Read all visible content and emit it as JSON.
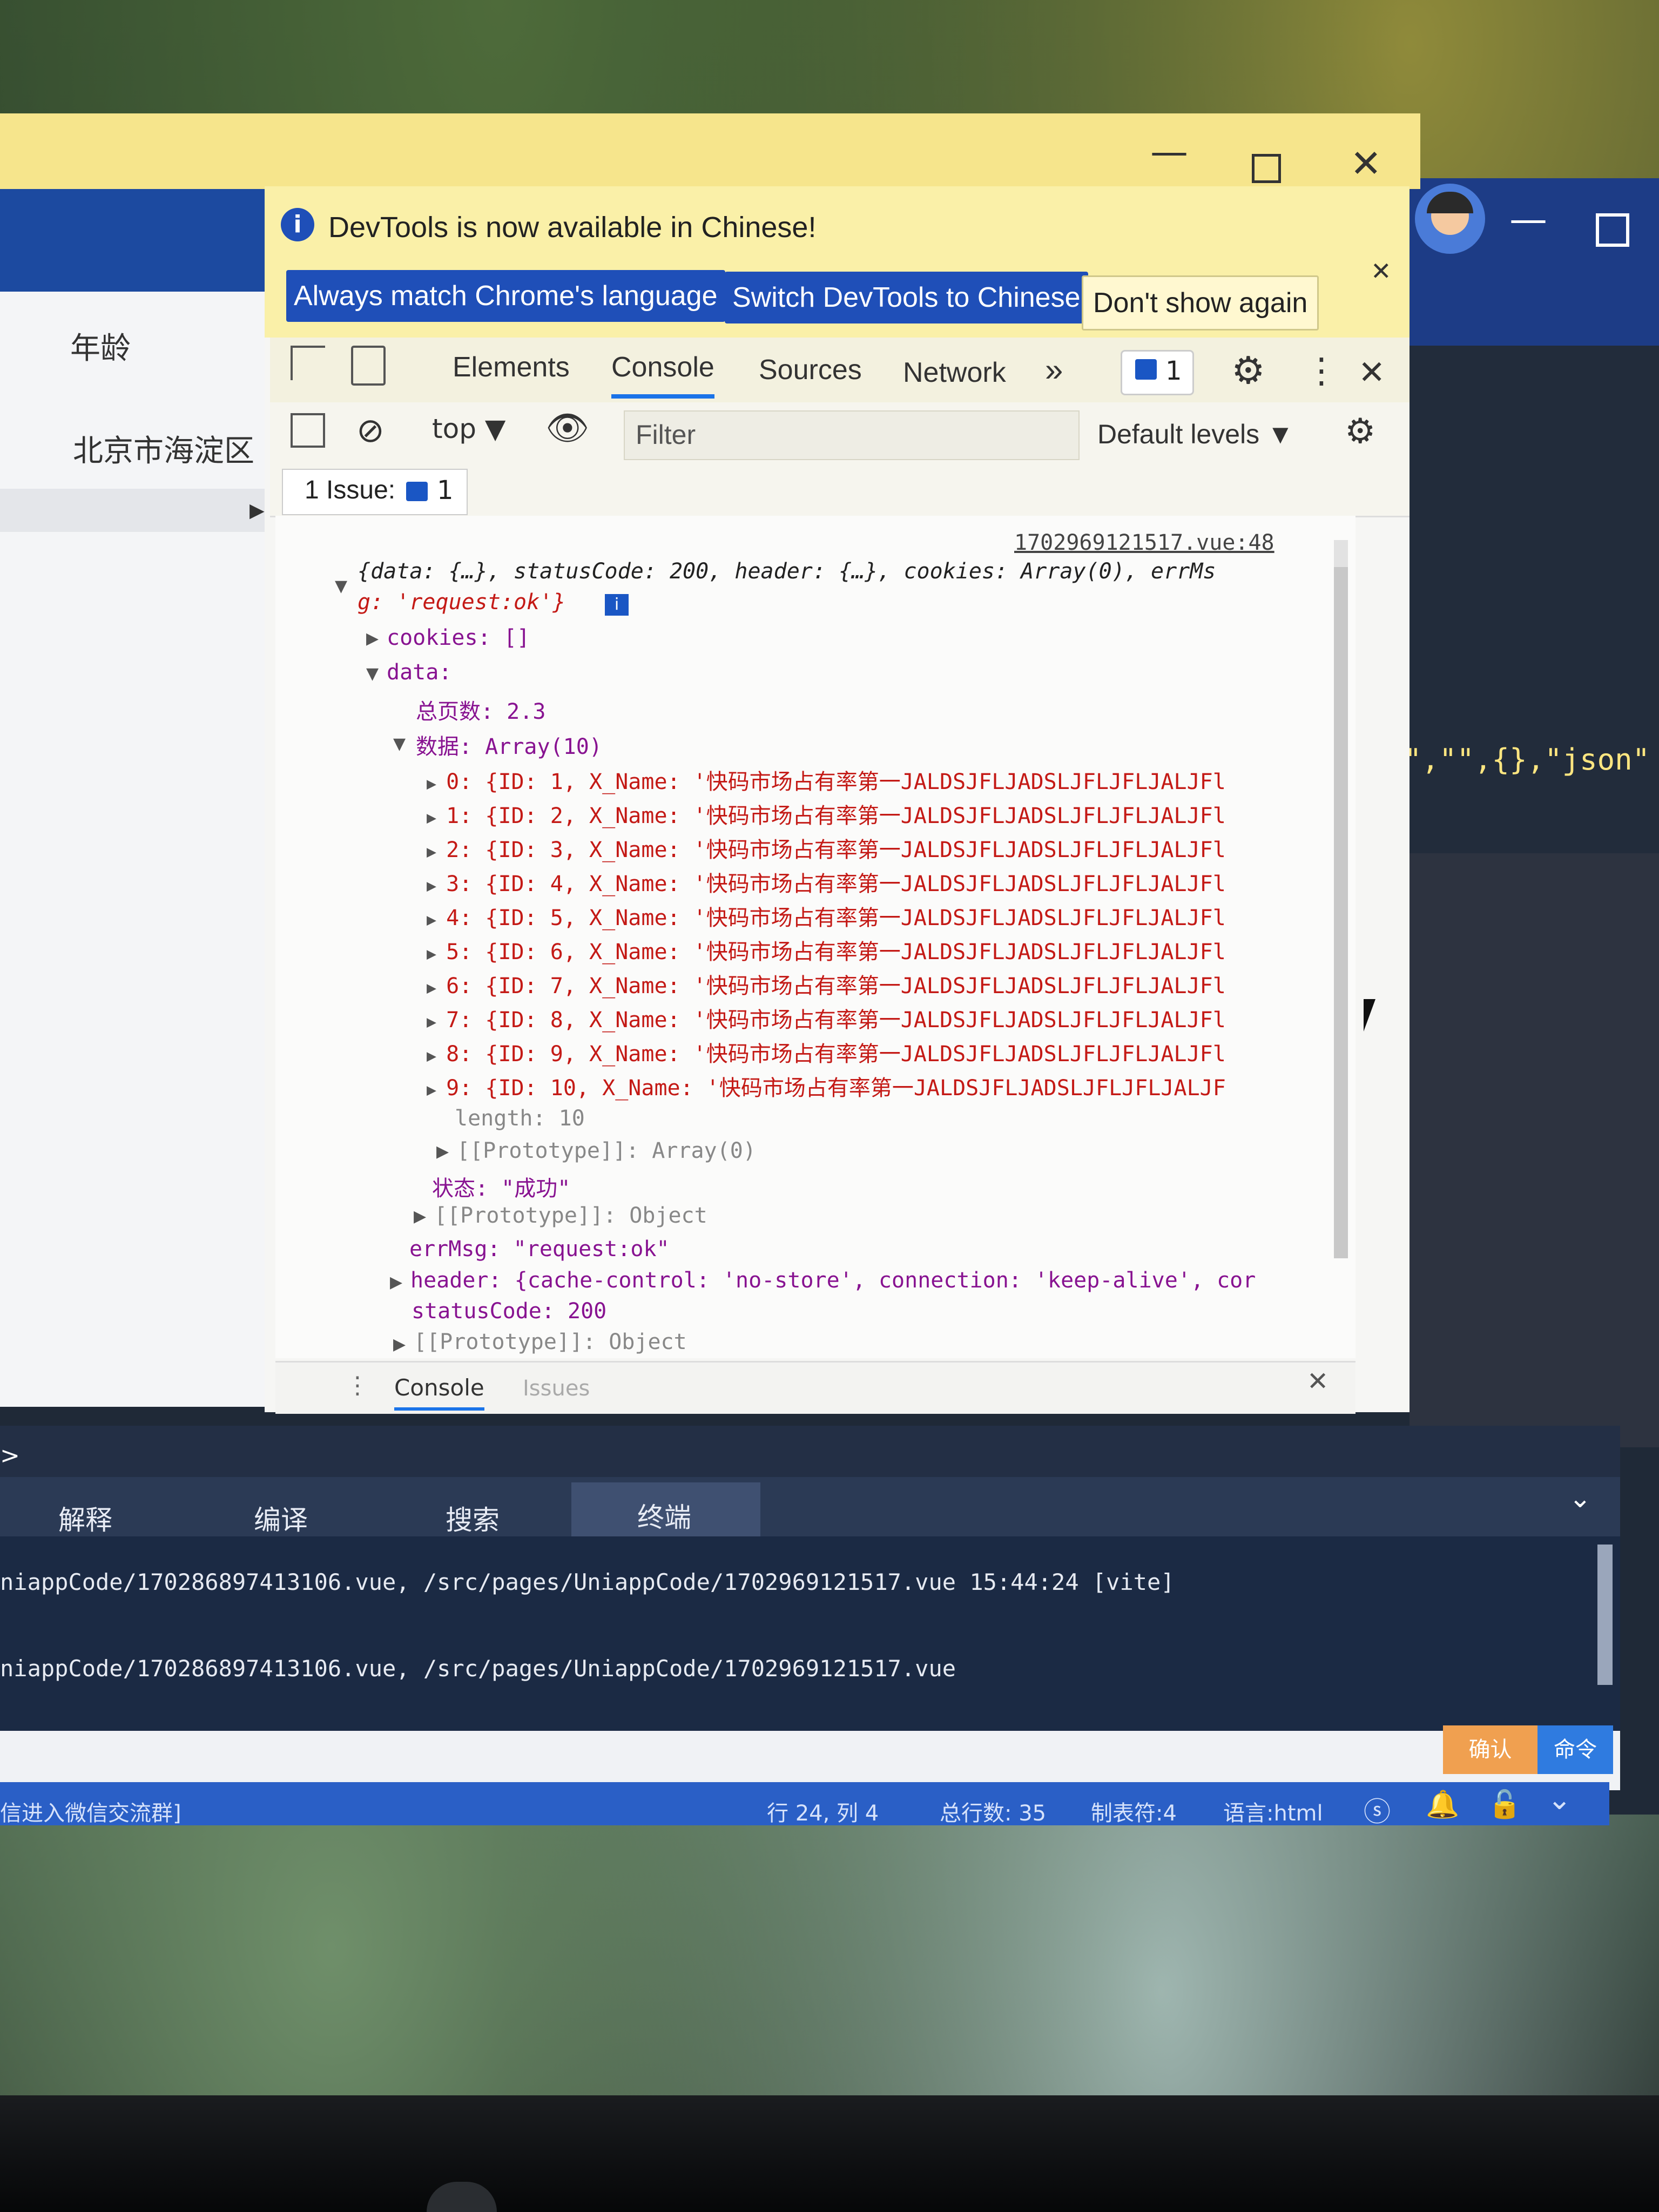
{
  "devtools": {
    "infobar": {
      "message": "DevTools is now available in Chinese!",
      "btn_match": "Always match Chrome's language",
      "btn_switch": "Switch DevTools to Chinese",
      "btn_dont": "Don't show again"
    },
    "tabs": {
      "elements": "Elements",
      "console": "Console",
      "sources": "Sources",
      "network": "Network",
      "more": "»",
      "issues_count": "1"
    },
    "toolbar": {
      "context": "top",
      "filter_placeholder": "Filter",
      "levels": "Default levels"
    },
    "issues_bar": {
      "label": "1 Issue:",
      "count": "1"
    },
    "console": {
      "source_link": "1702969121517.vue:48",
      "summary_1": "{data: {…}, statusCode: 200, header: {…}, cookies: Array(0), errMs",
      "summary_2": "g: 'request:ok'}",
      "cookies": "cookies: []",
      "data_key": "data:",
      "total_pages": "总页数: 2.3",
      "rows_key": "数据: Array(10)",
      "rows": [
        "0: {ID: 1, X_Name: '快码市场占有率第一JALDSJFLJADSLJFLJFLJALJFl",
        "1: {ID: 2, X_Name: '快码市场占有率第一JALDSJFLJADSLJFLJFLJALJFl",
        "2: {ID: 3, X_Name: '快码市场占有率第一JALDSJFLJADSLJFLJFLJALJFl",
        "3: {ID: 4, X_Name: '快码市场占有率第一JALDSJFLJADSLJFLJFLJALJFl",
        "4: {ID: 5, X_Name: '快码市场占有率第一JALDSJFLJADSLJFLJFLJALJFl",
        "5: {ID: 6, X_Name: '快码市场占有率第一JALDSJFLJADSLJFLJFLJALJFl",
        "6: {ID: 7, X_Name: '快码市场占有率第一JALDSJFLJADSLJFLJFLJALJFl",
        "7: {ID: 8, X_Name: '快码市场占有率第一JALDSJFLJADSLJFLJFLJALJFl",
        "8: {ID: 9, X_Name: '快码市场占有率第一JALDSJFLJADSLJFLJFLJALJFl",
        "9: {ID: 10, X_Name: '快码市场占有率第一JALDSJFLJADSLJFLJFLJALJF"
      ],
      "length": "length: 10",
      "proto_array": "[[Prototype]]: Array(0)",
      "status": "状态: \"成功\"",
      "proto_object_inner": "[[Prototype]]: Object",
      "errmsg": "errMsg: \"request:ok\"",
      "header": "header: {cache-control: 'no-store', connection: 'keep-alive', cor",
      "status_code": "statusCode: 200",
      "proto_object_outer": "[[Prototype]]: Object"
    },
    "drawer": {
      "console": "Console",
      "issues": "Issues"
    }
  },
  "editor": {
    "left_header": "年龄",
    "left_cell": "北京市海淀区",
    "json_fragment": "\",\"\",{},\"json\""
  },
  "panel": {
    "tabs": [
      "解释",
      "编译",
      "搜索",
      "终端"
    ],
    "terminal": [
      "niappCode/170286897413106.vue, /src/pages/UniappCode/1702969121517.vue 15:44:24 [vite]",
      "niappCode/170286897413106.vue, /src/pages/UniappCode/1702969121517.vue"
    ],
    "confirm": "确认",
    "command": "命令"
  },
  "statusbar": {
    "left": "信进入微信交流群]",
    "position": "行 24, 列 4",
    "total_lines": "总行数: 35",
    "tab": "制表符:4",
    "lang": "语言:html"
  }
}
